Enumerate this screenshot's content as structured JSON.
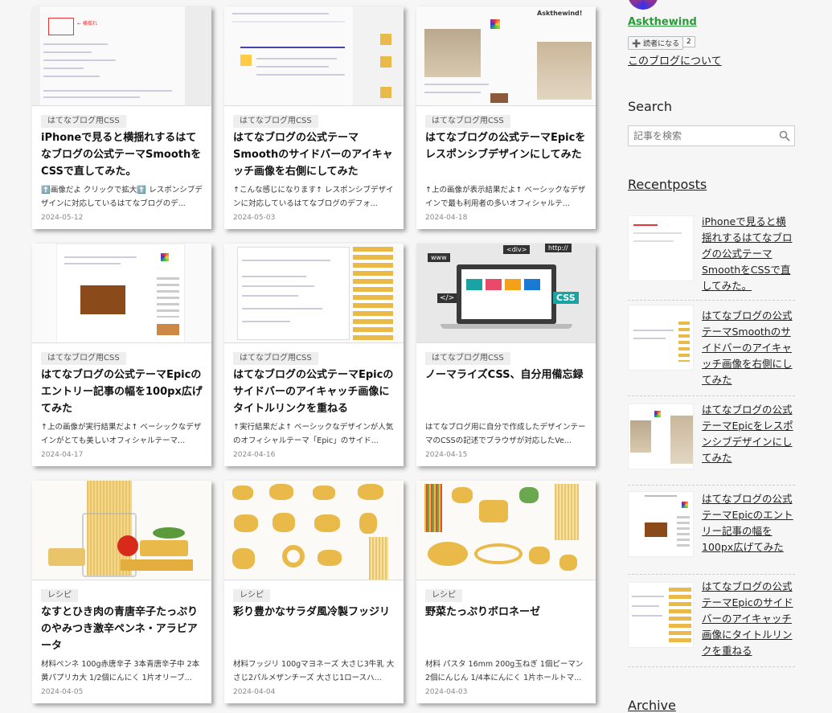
{
  "cards": [
    {
      "tag": "はてなブログ用CSS",
      "title": "iPhoneで見ると横揺れするはてなブログの公式テーマSmoothをCSSで直してみた。",
      "excerpt": "⬆️画像だよ クリックで拡大⬆️ レスポンシブデザインに対応しているはてなブログのデ...",
      "date": "2024-05-12"
    },
    {
      "tag": "はてなブログ用CSS",
      "title": "はてなブログの公式テーマSmoothのサイドバーのアイキャッチ画像を右側にしてみた",
      "excerpt": "↑こんな感じになります↑ レスポンシブデザインに対応しているはてなブログのデフォ...",
      "date": "2024-05-03"
    },
    {
      "tag": "はてなブログ用CSS",
      "title": "はてなブログの公式テーマEpicをレスポンシブデザインにしてみた",
      "excerpt": "↑上の画像が表示結果だよ↑ ベーシックなデザインで最も利用者の多いオフィシャルテ...",
      "date": "2024-04-18"
    },
    {
      "tag": "はてなブログ用CSS",
      "title": "はてなブログの公式テーマEpicのエントリー記事の幅を100px広げてみた",
      "excerpt": "↑上の画像が実行結果だよ↑ ベーシックなデザインがとても美しいオフィシャルテーマ...",
      "date": "2024-04-17"
    },
    {
      "tag": "はてなブログ用CSS",
      "title": "はてなブログの公式テーマEpicのサイドバーのアイキャッチ画像にタイトルリンクを重ねる",
      "excerpt": "↑実行結果だよ↑ ベーシックなデザインが人気のオフィシャルテーマ「Epic」のサイド...",
      "date": "2024-04-16"
    },
    {
      "tag": "はてなブログ用CSS",
      "title": "ノーマライズCSS、自分用備忘録",
      "excerpt": "はてなブログ用に自分で作成したデザインテーマのCSSの記述でブラウザが対応したVe...",
      "date": "2024-04-15"
    },
    {
      "tag": "レシピ",
      "title": "なすとひき肉の青唐辛子たっぷりのやみつき激辛ペンネ・アラビアータ",
      "excerpt": "材料ペンネ 100g赤唐辛子 3本青唐辛子中 2本黄パプリカ大 1/2個にんにく 1片オリーブ...",
      "date": "2024-04-05"
    },
    {
      "tag": "レシピ",
      "title": "彩り豊かなサラダ風冷製フッジリ",
      "excerpt": "材料フッジリ 100gマヨネーズ 大さじ3牛乳 大さじ2パルメザンチーズ 大さじ1ロースハ...",
      "date": "2024-04-04"
    },
    {
      "tag": "レシピ",
      "title": "野菜たっぷりボロネーゼ",
      "excerpt": "材料 パスタ 16mm 200g玉ねぎ 1個ピーマン 2個にんじん 1/4本にんにく 1片ホールトマ...",
      "date": "2024-04-03"
    }
  ],
  "sidebar": {
    "username": "Askthewind",
    "subscribe_label": "➕ 読者になる",
    "subscriber_count": "2",
    "about_label": "このブログについて",
    "search_heading": "Search",
    "search_placeholder": "記事を検索",
    "recent_heading": "Recentposts",
    "recent_posts": [
      "iPhoneで見ると横揺れするはてなブログの公式テーマSmoothをCSSで直してみた。",
      "はてなブログの公式テーマSmoothのサイドバーのアイキャッチ画像を右側にしてみた",
      "はてなブログの公式テーマEpicをレスポンシブデザインにしてみた",
      "はてなブログの公式テーマEpicのエントリー記事の幅を100px広げてみた",
      "はてなブログの公式テーマEpicのサイドバーのアイキャッチ画像にタイトルリンクを重ねる"
    ],
    "archive_heading": "Archive"
  },
  "thumb_texts": {
    "epic_brand": "Askthewind!",
    "css_labels": [
      "www",
      "<div>",
      "http://",
      "</>",
      "CSS"
    ]
  },
  "colors": {
    "username": "#2a9a3a",
    "pasta": "#e9b94a",
    "css_teal": "#1aa3a3"
  }
}
